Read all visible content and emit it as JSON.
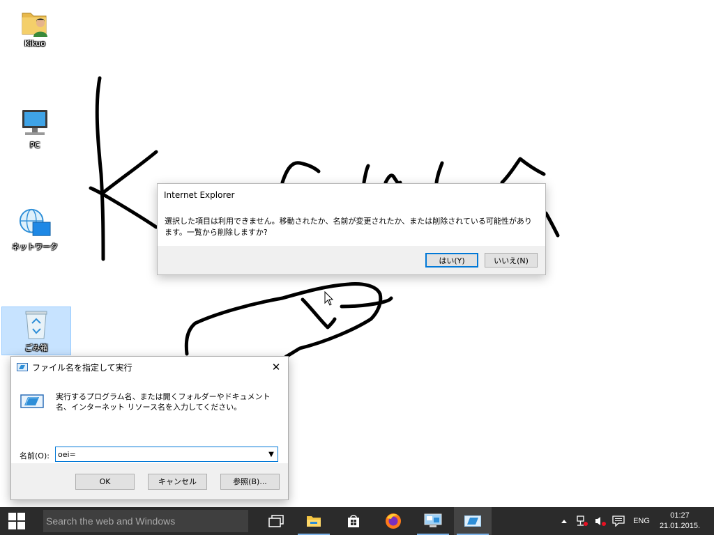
{
  "desktop": {
    "icons": [
      {
        "label": "Kikuo",
        "icon": "user-folder-icon"
      },
      {
        "label": "PC",
        "icon": "computer-icon"
      },
      {
        "label": "ネットワーク",
        "icon": "network-icon"
      },
      {
        "label": "ごみ箱",
        "icon": "recycle-bin-icon"
      }
    ]
  },
  "ie_dialog": {
    "title": "Internet Explorer",
    "message": "選択した項目は利用できません。移動されたか、名前が変更されたか、または削除されている可能性があります。一覧から削除しますか?",
    "yes_label": "はい(Y)",
    "no_label": "いいえ(N)"
  },
  "run_dialog": {
    "title": "ファイル名を指定して実行",
    "description": "実行するプログラム名、または開くフォルダーやドキュメント名、インターネット リソース名を入力してください。",
    "name_label": "名前(O):",
    "name_value": "oei=",
    "ok_label": "OK",
    "cancel_label": "キャンセル",
    "browse_label": "参照(B)...",
    "close_label": "✕"
  },
  "taskbar": {
    "search_placeholder": "Search the web and Windows",
    "apps": [
      {
        "icon": "task-view-icon"
      },
      {
        "icon": "file-explorer-icon"
      },
      {
        "icon": "store-icon"
      },
      {
        "icon": "firefox-icon"
      },
      {
        "icon": "remote-desktop-icon"
      },
      {
        "icon": "run-dialog-icon",
        "active": true
      }
    ],
    "tray": {
      "language": "ENG",
      "time": "01:27",
      "date": "21.01.2015."
    }
  },
  "colors": {
    "taskbar": "#2b2b2b",
    "accent": "#0078d7",
    "dialog_footer": "#f0f0f0"
  }
}
